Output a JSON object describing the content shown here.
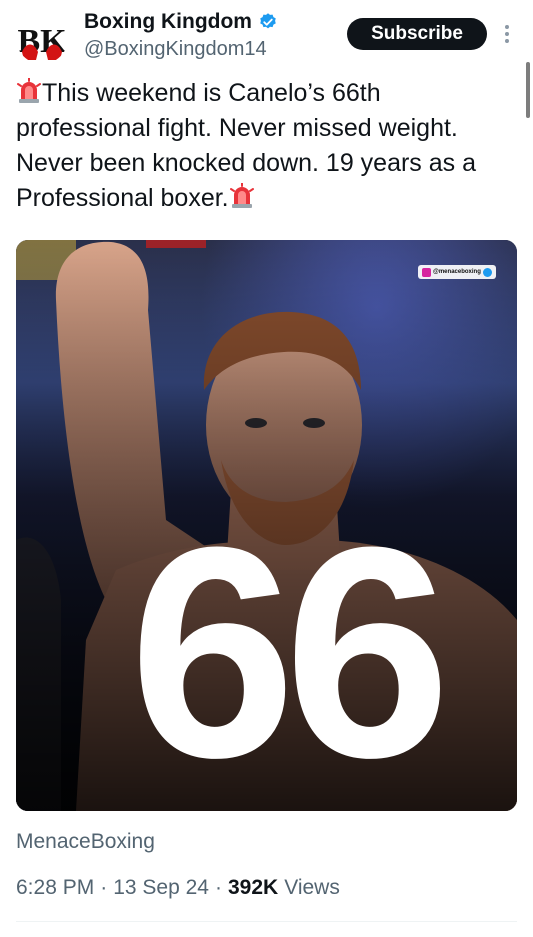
{
  "author": {
    "display_name": "Boxing Kingdom",
    "handle": "@BoxingKingdom14",
    "avatar_text": "BK",
    "verified": true
  },
  "header": {
    "subscribe_label": "Subscribe"
  },
  "tweet": {
    "text": "This weekend is Canelo’s 66th professional fight. Never missed weight. Never been knocked down. 19 years as a Professional boxer.",
    "emoji_leading": "police-light-icon",
    "emoji_trailing": "police-light-icon"
  },
  "media": {
    "overlay_number": "66",
    "watermark": "@menaceboxing"
  },
  "source": "MenaceBoxing",
  "meta": {
    "time": "6:28 PM",
    "date": "13 Sep 24",
    "views_count": "392K",
    "views_label": "Views",
    "separator": "·"
  },
  "colors": {
    "text_primary": "#0f1419",
    "text_secondary": "#536471",
    "verified": "#1d9bf0",
    "button_bg": "#0f1419"
  }
}
